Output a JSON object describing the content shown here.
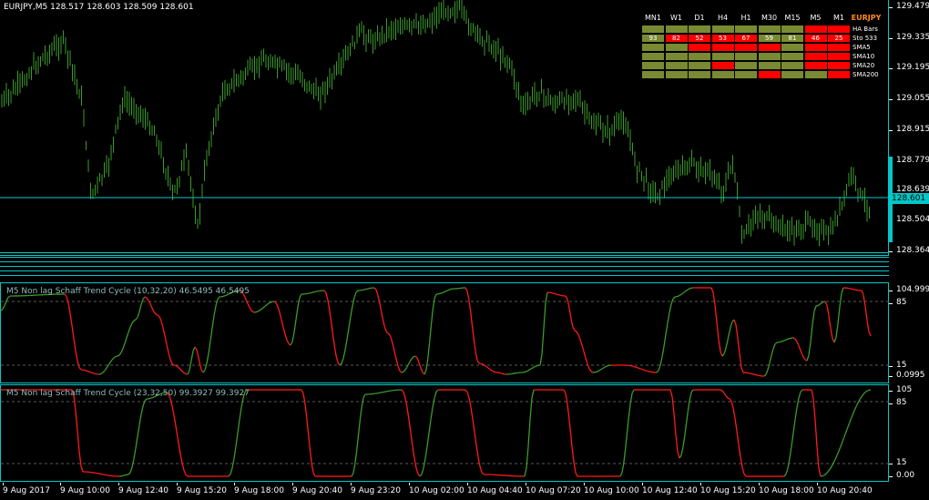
{
  "chart": {
    "title": "EURJPY,M5  128.517 128.603 128.509 128.601",
    "price_label": "128.601",
    "y_ticks": [
      "129.479",
      "129.335",
      "129.195",
      "129.055",
      "128.915",
      "128.779",
      "128.639",
      "128.504",
      "128.364"
    ],
    "colors": {
      "bull": "#3c9b2a",
      "bear": "#ff1a1a",
      "axis": "#00c8c8",
      "olive": "#8a9a3a"
    }
  },
  "indicator1": {
    "title": "M5 Non lag Schaff Trend Cycle  (10,32,20) 46.5495 46.5495",
    "y_ticks": [
      "104.9999",
      "85",
      "15",
      "0.0995"
    ]
  },
  "indicator2": {
    "title": "M5 Non lag Schaff Trend Cycle  (23,32,50) 99.3927 99.3927",
    "y_ticks": [
      "105",
      "85",
      "15",
      "0.00"
    ]
  },
  "x_ticks": [
    "9 Aug 2017",
    "9 Aug 10:00",
    "9 Aug 12:40",
    "9 Aug 15:20",
    "9 Aug 18:00",
    "9 Aug 20:40",
    "9 Aug 23:20",
    "10 Aug 02:00",
    "10 Aug 04:40",
    "10 Aug 07:20",
    "10 Aug 10:00",
    "10 Aug 12:40",
    "10 Aug 15:20",
    "10 Aug 18:00",
    "10 Aug 20:40"
  ],
  "panel": {
    "symbol": "EURJPY",
    "columns": [
      "MN1",
      "W1",
      "D1",
      "H4",
      "H1",
      "M30",
      "M15",
      "M5",
      "M1"
    ],
    "rows": [
      {
        "label": "HA Bars",
        "cells": [
          "g",
          "g",
          "g",
          "g",
          "g",
          "g",
          "g",
          "r",
          "r"
        ],
        "values": [
          "",
          "",
          "",
          "",
          "",
          "",
          "",
          "",
          ""
        ]
      },
      {
        "label": "Sto 533",
        "cells": [
          "g",
          "r",
          "r",
          "r",
          "r",
          "g",
          "g",
          "r",
          "r"
        ],
        "values": [
          "93",
          "82",
          "52",
          "53",
          "67",
          "59",
          "81",
          "46",
          "25"
        ]
      },
      {
        "label": "SMA5",
        "cells": [
          "g",
          "g",
          "r",
          "r",
          "r",
          "r",
          "g",
          "r",
          "r"
        ],
        "values": [
          "",
          "",
          "",
          "",
          "",
          "",
          "",
          "",
          ""
        ]
      },
      {
        "label": "SMA10",
        "cells": [
          "g",
          "g",
          "g",
          "g",
          "g",
          "g",
          "g",
          "r",
          "r"
        ],
        "values": [
          "",
          "",
          "",
          "",
          "",
          "",
          "",
          "",
          ""
        ]
      },
      {
        "label": "SMA20",
        "cells": [
          "g",
          "g",
          "g",
          "r",
          "g",
          "g",
          "g",
          "r",
          "r"
        ],
        "values": [
          "",
          "",
          "",
          "",
          "",
          "",
          "",
          "",
          ""
        ]
      },
      {
        "label": "SMA200",
        "cells": [
          "g",
          "g",
          "g",
          "g",
          "g",
          "r",
          "g",
          "g",
          "r"
        ],
        "values": [
          "",
          "",
          "",
          "",
          "",
          "",
          "",
          "",
          ""
        ]
      }
    ]
  }
}
